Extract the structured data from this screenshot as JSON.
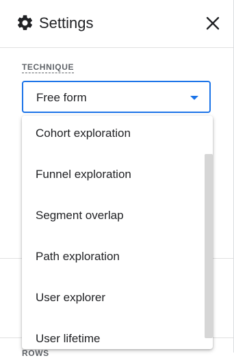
{
  "header": {
    "title": "Settings",
    "settings_icon": "gear-icon",
    "close_icon": "close-icon"
  },
  "technique": {
    "label": "TECHNIQUE",
    "selected": "Free form",
    "dropdown_icon": "caret-down-icon"
  },
  "dropdown": {
    "options": [
      "Cohort exploration",
      "Funnel exploration",
      "Segment overlap",
      "Path exploration",
      "User explorer",
      "User lifetime"
    ]
  },
  "partially_hidden_label": "ROWS",
  "colors": {
    "accent": "#1a73e8",
    "text": "#202124",
    "muted": "#5f6368"
  }
}
